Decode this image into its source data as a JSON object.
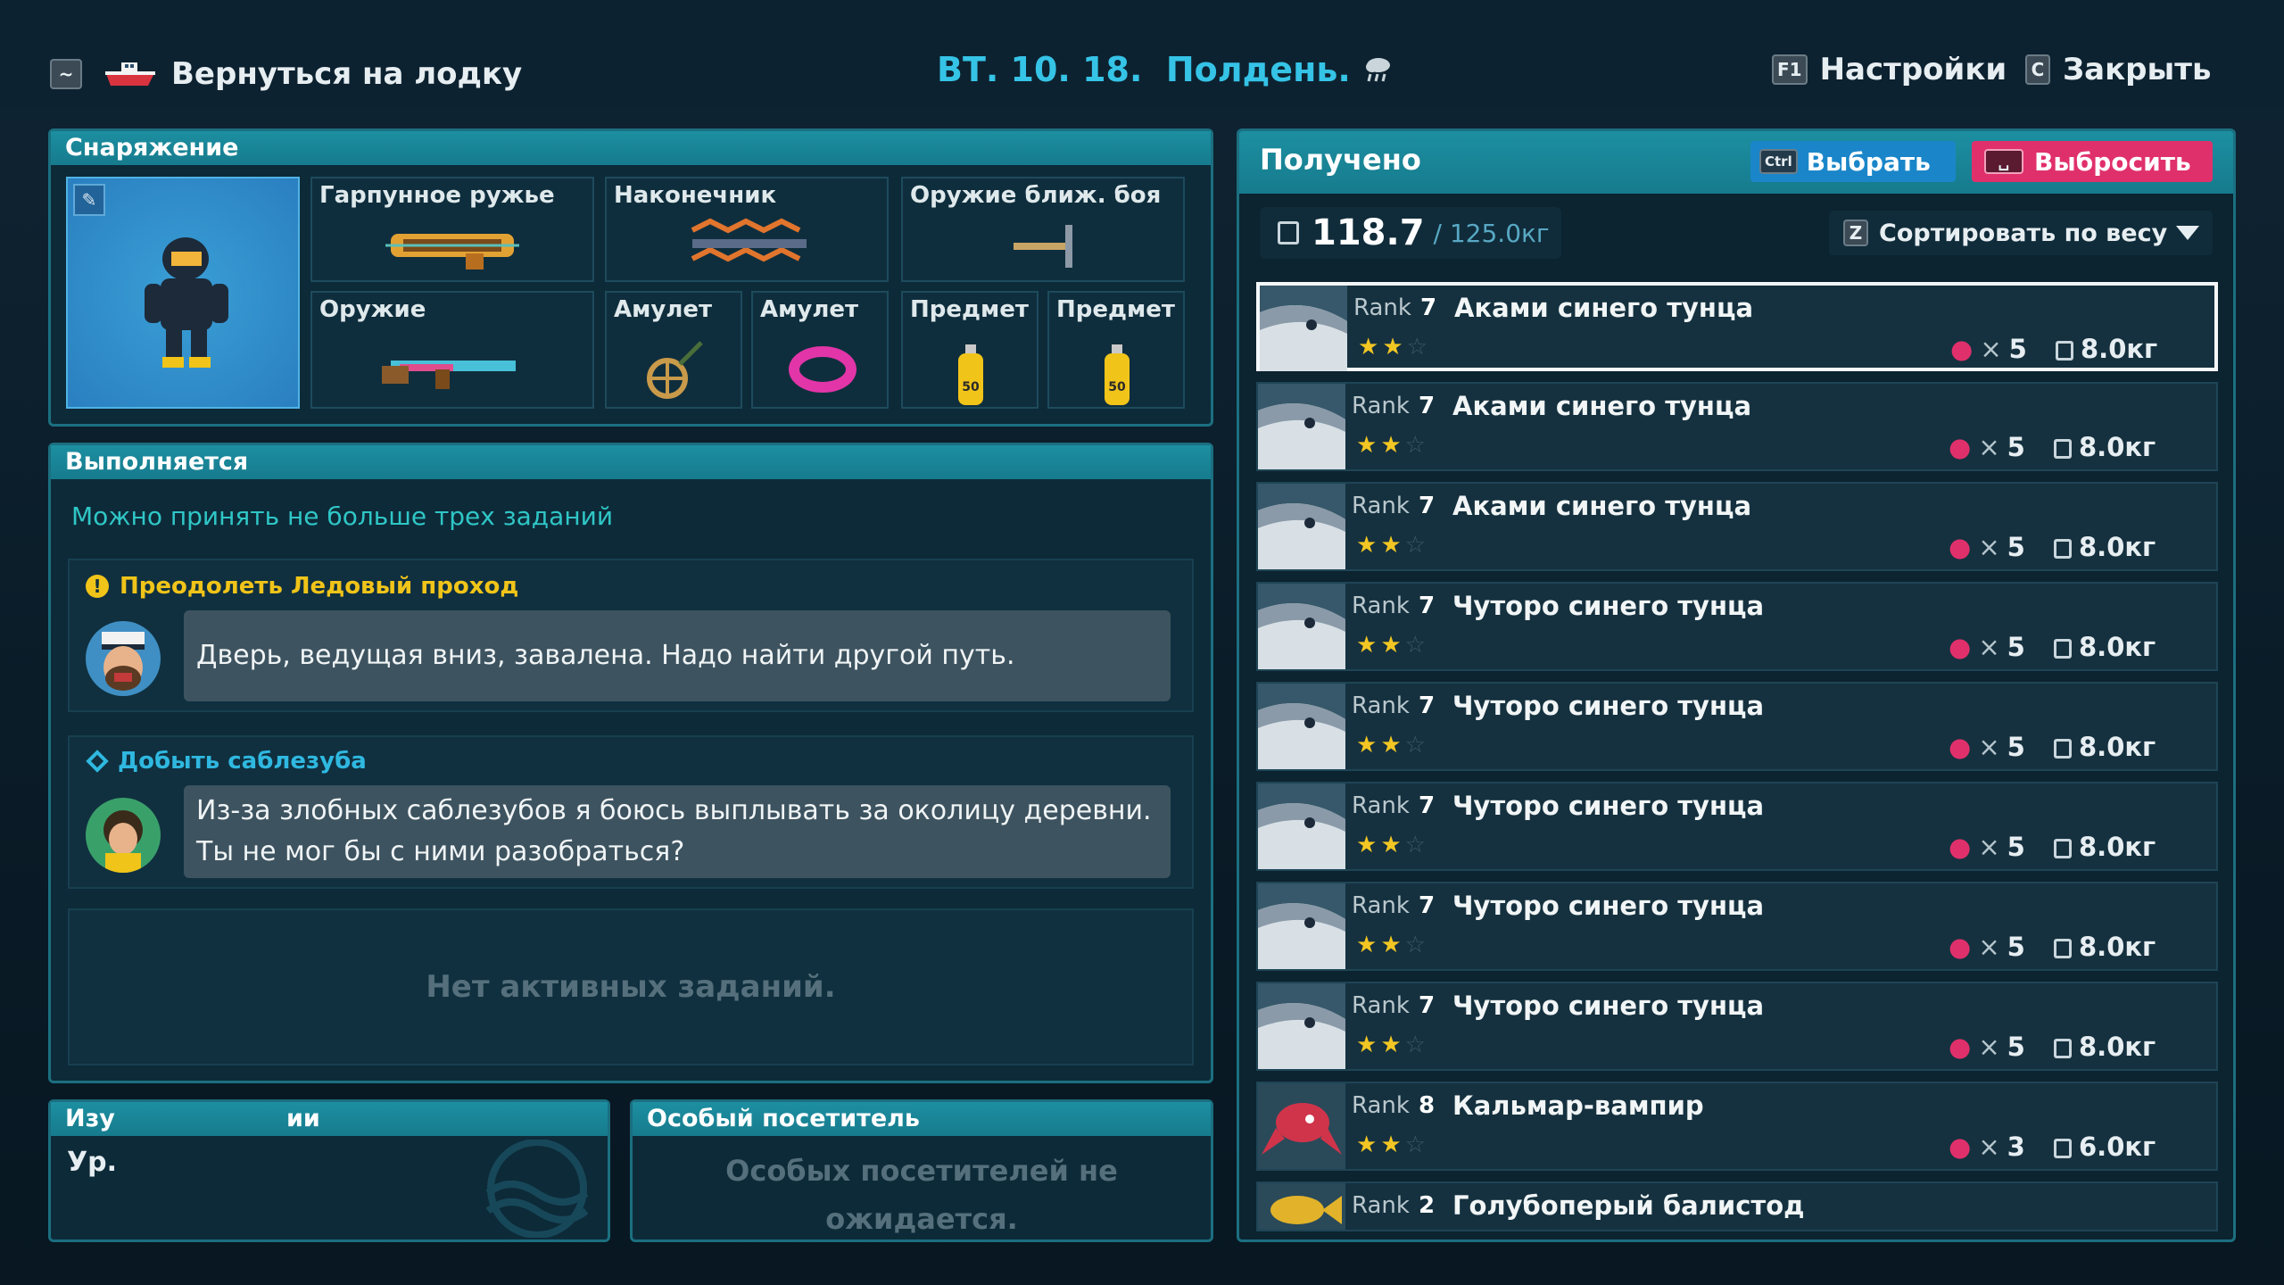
{
  "topbar": {
    "left_key": "~",
    "back_label": "Вернуться на лодку",
    "date_time": "ВТ. 10. 18.  Полдень.",
    "settings_key": "F1",
    "settings_label": "Настройки",
    "close_key": "C",
    "close_label": "Закрыть"
  },
  "equipment": {
    "title": "Снаряжение",
    "slots": [
      {
        "label": "Гарпунное ружье",
        "icon": "harpoon-gun-icon"
      },
      {
        "label": "Наконечник",
        "icon": "harpoon-tip-icon"
      },
      {
        "label": "Оружие ближ. боя",
        "icon": "melee-weapon-icon"
      },
      {
        "label": "Оружие",
        "icon": "rifle-icon"
      },
      {
        "label": "Амулет",
        "icon": "wheel-amulet-icon"
      },
      {
        "label": "Амулет",
        "icon": "bracelet-amulet-icon"
      },
      {
        "label": "Предмет",
        "icon": "oxygen-tank-icon",
        "badge": "50"
      },
      {
        "label": "Предмет",
        "icon": "oxygen-tank-icon",
        "badge": "50"
      }
    ]
  },
  "quests": {
    "title": "Выполняется",
    "limit_note": "Можно принять не больше трех заданий",
    "items": [
      {
        "title": "Преодолеть Ледовый проход",
        "message": "Дверь, ведущая вниз, завалена. Надо найти другой путь.",
        "color": "#f0c419"
      },
      {
        "title": "Добыть саблезуба",
        "message_line1": "Из-за злобных саблезубов я боюсь выплывать за околицу деревни.",
        "message_line2": "Ты не мог бы с ними разобраться?",
        "color": "#2fb8e0"
      }
    ],
    "empty": "Нет активных заданий."
  },
  "research": {
    "title_prefix": "Изу",
    "title_suffix": "ии",
    "level_label": "Ур."
  },
  "visitor": {
    "title": "Особый посетитель",
    "message_line1": "Особых посетителей не",
    "message_line2": "ожидается."
  },
  "received": {
    "title": "Получено",
    "select_key": "Ctrl",
    "select_label": "Выбрать",
    "discard_key": "␣",
    "discard_label": "Выбросить",
    "weight_current": "118.7",
    "weight_max": "/ 125.0кг",
    "sort_key": "Z",
    "sort_label": "Сортировать по весу",
    "items": [
      {
        "rank_label": "Rank",
        "rank": "7",
        "name": "Аками синего тунца",
        "stars": 2,
        "qty_x": "×",
        "qty": "5",
        "weight": "8.0кг",
        "selected": true
      },
      {
        "rank_label": "Rank",
        "rank": "7",
        "name": "Аками синего тунца",
        "stars": 2,
        "qty_x": "×",
        "qty": "5",
        "weight": "8.0кг"
      },
      {
        "rank_label": "Rank",
        "rank": "7",
        "name": "Аками синего тунца",
        "stars": 2,
        "qty_x": "×",
        "qty": "5",
        "weight": "8.0кг"
      },
      {
        "rank_label": "Rank",
        "rank": "7",
        "name": "Чуторо синего тунца",
        "stars": 2,
        "qty_x": "×",
        "qty": "5",
        "weight": "8.0кг"
      },
      {
        "rank_label": "Rank",
        "rank": "7",
        "name": "Чуторо синего тунца",
        "stars": 2,
        "qty_x": "×",
        "qty": "5",
        "weight": "8.0кг"
      },
      {
        "rank_label": "Rank",
        "rank": "7",
        "name": "Чуторо синего тунца",
        "stars": 2,
        "qty_x": "×",
        "qty": "5",
        "weight": "8.0кг"
      },
      {
        "rank_label": "Rank",
        "rank": "7",
        "name": "Чуторо синего тунца",
        "stars": 2,
        "qty_x": "×",
        "qty": "5",
        "weight": "8.0кг"
      },
      {
        "rank_label": "Rank",
        "rank": "7",
        "name": "Чуторо синего тунца",
        "stars": 2,
        "qty_x": "×",
        "qty": "5",
        "weight": "8.0кг"
      },
      {
        "rank_label": "Rank",
        "rank": "8",
        "name": "Кальмар-вампир",
        "stars": 2,
        "qty_x": "×",
        "qty": "3",
        "weight": "6.0кг"
      },
      {
        "rank_label": "Rank",
        "rank": "2",
        "name": "Голубоперый балистод"
      }
    ]
  },
  "colors": {
    "panel_header": "#1c8fa1",
    "select_button": "#1a86c9",
    "discard_button": "#e0306c",
    "date_color": "#35c3e6",
    "star_on": "#f2c623"
  }
}
